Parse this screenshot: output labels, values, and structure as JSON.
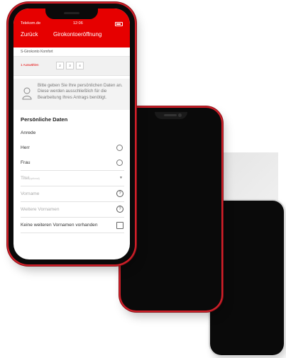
{
  "status": {
    "carrier": "Telekom.de",
    "time": "12:06"
  },
  "nav": {
    "back": "Zurück",
    "title": "Girokontoeröffnung"
  },
  "subtitle": "S-Girokonto Komfort",
  "steps": {
    "active": "1 Auswählen",
    "items": [
      "2",
      "3",
      "4"
    ]
  },
  "info": {
    "icon": "person-icon",
    "text": "Bitte geben Sie Ihre persönlichen Daten an. Diese werden ausschließlich für die Bearbeitung Ihres Antrags benötigt."
  },
  "form": {
    "section_title": "Persönliche Daten",
    "anrede_label": "Anrede",
    "option_herr": "Herr",
    "option_frau": "Frau",
    "titel_label": "Titel",
    "titel_hint": "(optional)",
    "vorname_placeholder": "Vorname",
    "weitere_vornamen_placeholder": "Weitere Vornamen",
    "keine_vornamen_label": "Keine weiteren Vornamen vorhanden"
  },
  "colors": {
    "brand_red": "#e60000",
    "phone_frame": "#d0202a"
  }
}
